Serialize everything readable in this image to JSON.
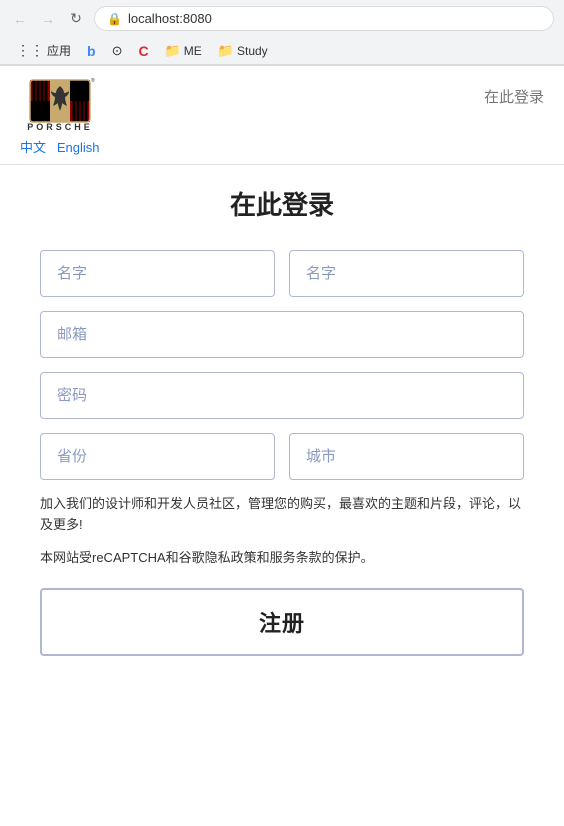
{
  "browser": {
    "url": "localhost:8080",
    "back_disabled": true,
    "forward_disabled": true,
    "bookmarks": [
      {
        "id": "apps",
        "label": "应用"
      },
      {
        "id": "b",
        "label": ""
      },
      {
        "id": "github",
        "label": ""
      },
      {
        "id": "codepen",
        "label": ""
      },
      {
        "id": "me",
        "label": "ME"
      },
      {
        "id": "study",
        "label": "Study"
      }
    ]
  },
  "header": {
    "login_link": "在此登录",
    "lang_zh": "中文",
    "lang_en": "English"
  },
  "form": {
    "title": "在此登录",
    "first_name_placeholder": "名字",
    "last_name_placeholder": "名字",
    "email_placeholder": "邮箱",
    "password_placeholder": "密码",
    "province_placeholder": "省份",
    "city_placeholder": "城市",
    "desc_text": "加入我们的设计师和开发人员社区，管理您的购买，最喜欢的主题和片段，评论，以及更多!",
    "recaptcha_text": "本网站受reCAPTCHA和谷歌隐私政策和服务条款的保护。",
    "submit_label": "注册"
  }
}
